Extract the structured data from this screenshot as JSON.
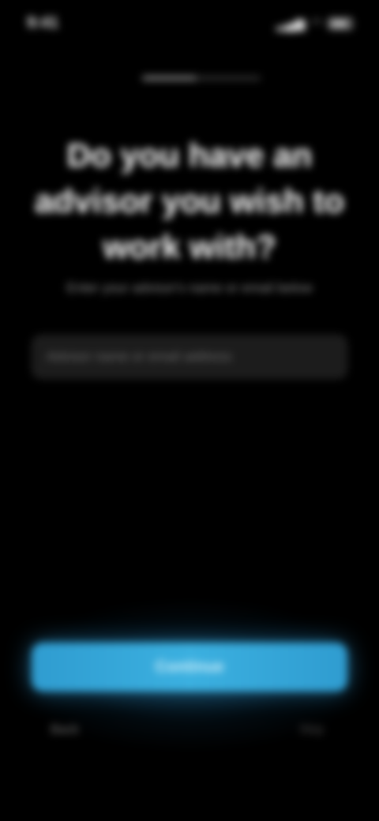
{
  "status_bar": {
    "time": "9:41",
    "signal_icon": "signal-icon",
    "wifi_icon": "wifi-icon",
    "battery_icon": "battery-icon"
  },
  "progress": {
    "fraction": 0.45
  },
  "question": {
    "title": "Do you have an advisor you wish to work with?",
    "subtitle": "Enter your advisor's name or email below"
  },
  "input": {
    "value": "",
    "placeholder": "Advisor name or email address"
  },
  "actions": {
    "continue_label": "Continue",
    "left_link": "Back",
    "right_link": "Skip"
  },
  "colors": {
    "background": "#000000",
    "accent": "#3bb0e0",
    "field": "#1c1c1c",
    "muted_text": "#8f8f8f"
  }
}
